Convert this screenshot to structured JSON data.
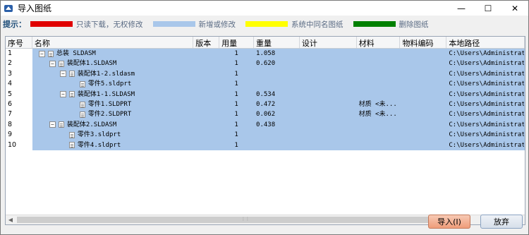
{
  "window": {
    "title": "导入图纸"
  },
  "legend": {
    "label": "提示：",
    "items": [
      {
        "color": "#e00000",
        "text": "只读下载，无权修改"
      },
      {
        "color": "#a9c7ea",
        "text": "新增或修改"
      },
      {
        "color": "#ffff00",
        "text": "系统中同名图纸"
      },
      {
        "color": "#008000",
        "text": "删除图纸"
      }
    ]
  },
  "table": {
    "columns": [
      "序号",
      "名称",
      "版本",
      "用量",
      "重量",
      "设计",
      "材料",
      "物料编码",
      "本地路径"
    ],
    "rows": [
      {
        "no": "1",
        "name": "总装 SLDASM",
        "depth": 0,
        "type": "asm",
        "qty": "1",
        "weight": "1.058",
        "material": "",
        "path": "C:\\Users\\Administrator\\"
      },
      {
        "no": "2",
        "name": "装配体1.SLDASM",
        "depth": 1,
        "type": "asm",
        "qty": "1",
        "weight": "0.620",
        "material": "",
        "path": "C:\\Users\\Administrator\\"
      },
      {
        "no": "3",
        "name": "装配体1-2.sldasm",
        "depth": 2,
        "type": "asm",
        "qty": "1",
        "weight": "",
        "material": "",
        "path": "C:\\Users\\Administrator\\"
      },
      {
        "no": "4",
        "name": "零件5.sldprt",
        "depth": 3,
        "type": "prt",
        "qty": "1",
        "weight": "",
        "material": "",
        "path": "C:\\Users\\Administrator\\"
      },
      {
        "no": "5",
        "name": "装配体1-1.SLDASM",
        "depth": 2,
        "type": "asm",
        "qty": "1",
        "weight": "0.534",
        "material": "",
        "path": "C:\\Users\\Administrator\\"
      },
      {
        "no": "6",
        "name": "零件1.SLDPRT",
        "depth": 3,
        "type": "prt",
        "qty": "1",
        "weight": "0.472",
        "material": "材质 <未...",
        "path": "C:\\Users\\Administrator\\"
      },
      {
        "no": "7",
        "name": "零件2.SLDPRT",
        "depth": 3,
        "type": "prt",
        "qty": "1",
        "weight": "0.062",
        "material": "材质 <未...",
        "path": "C:\\Users\\Administrator\\"
      },
      {
        "no": "8",
        "name": "装配体2.SLDASM",
        "depth": 1,
        "type": "asm",
        "qty": "1",
        "weight": "0.438",
        "material": "",
        "path": "C:\\Users\\Administrator\\"
      },
      {
        "no": "9",
        "name": "零件3.sldprt",
        "depth": 2,
        "type": "prt",
        "qty": "1",
        "weight": "",
        "material": "",
        "path": "C:\\Users\\Administrator\\"
      },
      {
        "no": "10",
        "name": "零件4.sldprt",
        "depth": 2,
        "type": "prt",
        "qty": "1",
        "weight": "",
        "material": "",
        "path": "C:\\Users\\Administrator\\"
      }
    ]
  },
  "footer": {
    "import_label": "导入(I)",
    "cancel_label": "放弃"
  },
  "icons": {
    "app": "app-logo-icon",
    "minimize": "minimize-icon",
    "maximize": "maximize-icon",
    "close": "close-icon"
  }
}
